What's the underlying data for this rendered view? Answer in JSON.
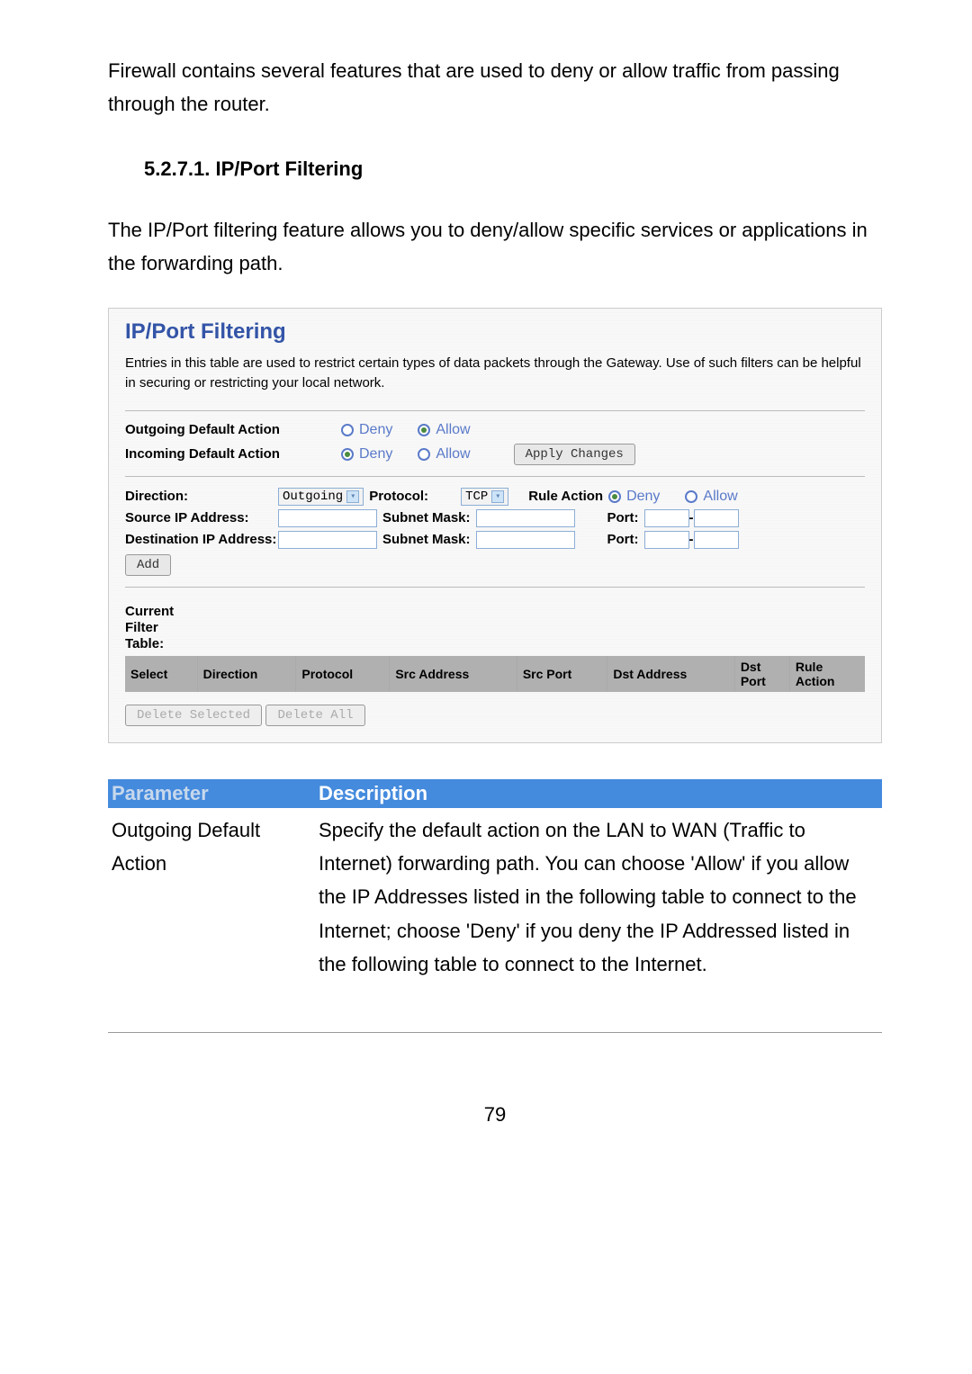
{
  "intro": "Firewall contains several features that are used to deny or allow traffic from passing through the router.",
  "section": {
    "num": "5.2.7.1. IP/Port Filtering",
    "desc": "The IP/Port filtering feature allows you to deny/allow specific services or applications in the forwarding path."
  },
  "panel": {
    "title": "IP/Port Filtering",
    "note": "Entries in this table are used to restrict certain types of data packets through the Gateway. Use of such filters can be helpful in securing or restricting your local network.",
    "outgoing_label": "Outgoing Default Action",
    "incoming_label": "Incoming Default Action",
    "deny": "Deny",
    "allow": "Allow",
    "apply_btn": "Apply Changes",
    "direction_label": "Direction:",
    "direction_value": "Outgoing",
    "protocol_label": "Protocol:",
    "protocol_value": "TCP",
    "rule_action_label": "Rule Action",
    "src_ip_label": "Source IP Address:",
    "dst_ip_label": "Destination IP Address:",
    "subnet_mask_label": "Subnet Mask:",
    "port_label": "Port:",
    "add_btn": "Add",
    "table_heading": "Current Filter Table:",
    "columns": {
      "select": "Select",
      "direction": "Direction",
      "protocol": "Protocol",
      "src_addr": "Src Address",
      "src_port": "Src Port",
      "dst_addr": "Dst Address",
      "dst_port1": "Dst",
      "dst_port2": "Port",
      "rule1": "Rule",
      "rule2": "Action"
    },
    "del_sel_btn": "Delete Selected",
    "del_all_btn": "Delete All"
  },
  "param_table": {
    "header_param": "Parameter",
    "header_desc": "Description",
    "row_param": "Outgoing Default Action",
    "row_desc": "Specify the default action on the LAN to WAN (Traffic to Internet) forwarding path. You can choose 'Allow' if you allow the IP Addresses listed in the following table to connect to the Internet; choose 'Deny' if you deny the IP Addressed listed in the following table to connect to the Internet."
  },
  "page_number": "79"
}
